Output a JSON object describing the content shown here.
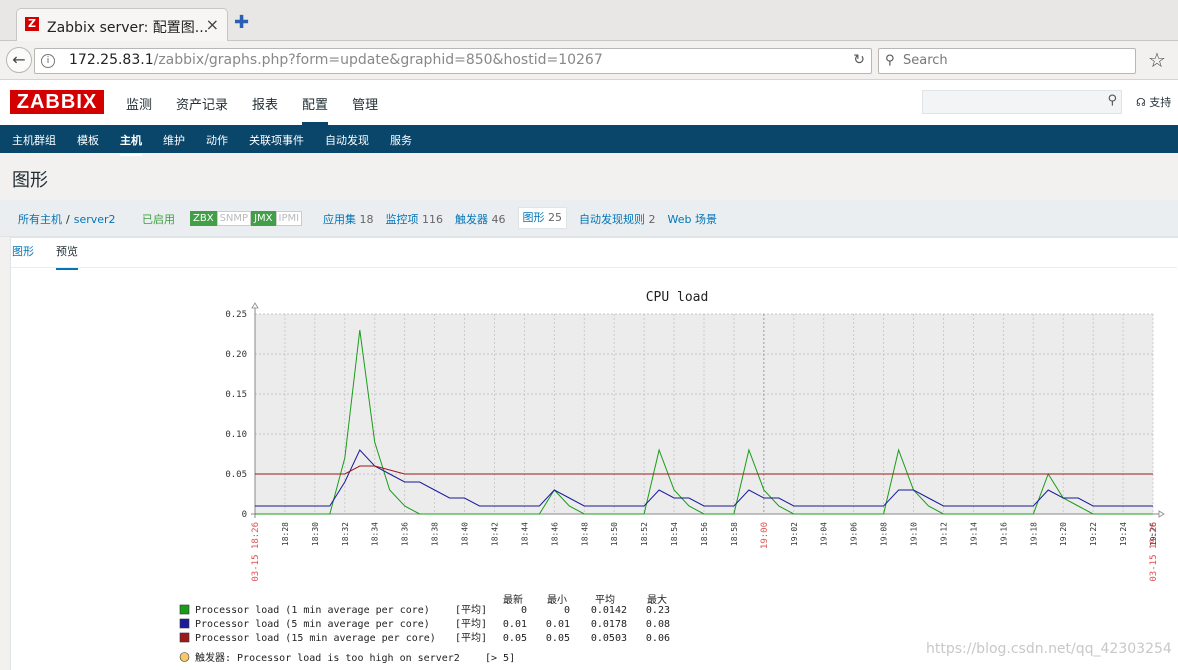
{
  "browser": {
    "tab_title": "Zabbix server: 配置图...",
    "tab_close": "×",
    "newtab": "✚",
    "favicon_text": "Z",
    "url_host": "172.25.83.1",
    "url_path": "/zabbix/graphs.php?form=update&graphid=850&hostid=10267",
    "search_placeholder": "Search"
  },
  "header": {
    "logo": "ZABBIX",
    "nav": [
      "监测",
      "资产记录",
      "报表",
      "配置",
      "管理"
    ],
    "active_nav": 3,
    "support": "支持"
  },
  "subnav": {
    "items": [
      "主机群组",
      "模板",
      "主机",
      "维护",
      "动作",
      "关联项事件",
      "自动发现",
      "服务"
    ],
    "active": 2
  },
  "page": {
    "title": "图形",
    "crumb_all": "所有主机",
    "crumb_sep": "/",
    "crumb_host": "server2",
    "status": "已启用",
    "availability": [
      "ZBX",
      "SNMP",
      "JMX",
      "IPMI"
    ],
    "host_links": [
      {
        "label": "应用集",
        "count": "18"
      },
      {
        "label": "监控项",
        "count": "116"
      },
      {
        "label": "触发器",
        "count": "46"
      },
      {
        "label": "图形",
        "count": "25"
      },
      {
        "label": "自动发现规则",
        "count": "2"
      },
      {
        "label": "Web 场景",
        "count": ""
      }
    ],
    "tabs": [
      "图形",
      "预览"
    ],
    "active_tab": 1
  },
  "colors": {
    "series1": "#1a9c1a",
    "series2": "#1a1a9c",
    "series3": "#9c1a1a",
    "trigger": "#f5c96a",
    "date_label": "#e05050"
  },
  "chart_data": {
    "type": "line",
    "title": "CPU load",
    "ylim": [
      0,
      0.25
    ],
    "yticks": [
      "0.25",
      "0.20",
      "0.15",
      "0.10",
      "0.05",
      "0"
    ],
    "ytick_values": [
      0.25,
      0.2,
      0.15,
      0.1,
      0.05,
      0
    ],
    "x_start": "18:26",
    "x_end": "19:26",
    "date_start": "03-15 18:26",
    "date_end": "03-15 19:26",
    "x_major": "19:00",
    "xtick_labels": [
      "18:28",
      "18:30",
      "18:32",
      "18:34",
      "18:36",
      "18:38",
      "18:40",
      "18:42",
      "18:44",
      "18:46",
      "18:48",
      "18:50",
      "18:52",
      "18:54",
      "18:56",
      "18:58",
      "19:00",
      "19:02",
      "19:04",
      "19:06",
      "19:08",
      "19:10",
      "19:12",
      "19:14",
      "19:16",
      "19:18",
      "19:20",
      "19:22",
      "19:24",
      "19:26"
    ],
    "legend_headers": [
      "最新",
      "最小",
      "平均",
      "最大"
    ],
    "series": [
      {
        "name": "Processor load (1 min average per core)",
        "agg": "[平均]",
        "last": "0",
        "min": "0",
        "avg": "0.0142",
        "max": "0.23",
        "minutes": [
          0,
          1,
          2,
          3,
          4,
          5,
          6,
          7,
          8,
          9,
          10,
          11,
          12,
          13,
          14,
          15,
          16,
          17,
          18,
          19,
          20,
          21,
          22,
          23,
          24,
          25,
          26,
          27,
          28,
          29,
          30,
          31,
          32,
          33,
          34,
          35,
          36,
          37,
          38,
          39,
          40,
          41,
          42,
          43,
          44,
          45,
          46,
          47,
          48,
          49,
          50,
          51,
          52,
          53,
          54,
          55,
          56,
          57,
          58,
          59,
          60
        ],
        "values": [
          0,
          0,
          0,
          0,
          0,
          0,
          0.07,
          0.23,
          0.09,
          0.03,
          0.01,
          0,
          0,
          0,
          0,
          0,
          0,
          0,
          0,
          0,
          0.03,
          0.01,
          0,
          0,
          0,
          0,
          0,
          0.08,
          0.03,
          0.01,
          0,
          0,
          0,
          0.08,
          0.03,
          0.01,
          0,
          0,
          0,
          0,
          0,
          0,
          0,
          0.08,
          0.03,
          0.01,
          0,
          0,
          0,
          0,
          0,
          0,
          0,
          0.05,
          0.02,
          0.01,
          0,
          0,
          0,
          0,
          0
        ]
      },
      {
        "name": "Processor load (5 min average per core)",
        "agg": "[平均]",
        "last": "0.01",
        "min": "0.01",
        "avg": "0.0178",
        "max": "0.08",
        "minutes": [
          0,
          1,
          2,
          3,
          4,
          5,
          6,
          7,
          8,
          9,
          10,
          11,
          12,
          13,
          14,
          15,
          16,
          17,
          18,
          19,
          20,
          21,
          22,
          23,
          24,
          25,
          26,
          27,
          28,
          29,
          30,
          31,
          32,
          33,
          34,
          35,
          36,
          37,
          38,
          39,
          40,
          41,
          42,
          43,
          44,
          45,
          46,
          47,
          48,
          49,
          50,
          51,
          52,
          53,
          54,
          55,
          56,
          57,
          58,
          59,
          60
        ],
        "values": [
          0.01,
          0.01,
          0.01,
          0.01,
          0.01,
          0.01,
          0.04,
          0.08,
          0.06,
          0.05,
          0.04,
          0.04,
          0.03,
          0.02,
          0.02,
          0.01,
          0.01,
          0.01,
          0.01,
          0.01,
          0.03,
          0.02,
          0.01,
          0.01,
          0.01,
          0.01,
          0.01,
          0.03,
          0.02,
          0.02,
          0.01,
          0.01,
          0.01,
          0.03,
          0.02,
          0.02,
          0.01,
          0.01,
          0.01,
          0.01,
          0.01,
          0.01,
          0.01,
          0.03,
          0.03,
          0.02,
          0.01,
          0.01,
          0.01,
          0.01,
          0.01,
          0.01,
          0.01,
          0.03,
          0.02,
          0.02,
          0.01,
          0.01,
          0.01,
          0.01,
          0.01
        ]
      },
      {
        "name": "Processor load (15 min average per core)",
        "agg": "[平均]",
        "last": "0.05",
        "min": "0.05",
        "avg": "0.0503",
        "max": "0.06",
        "minutes": [
          0,
          1,
          2,
          3,
          4,
          5,
          6,
          7,
          8,
          9,
          10,
          11,
          12,
          13,
          14,
          15,
          16,
          17,
          18,
          19,
          20,
          21,
          22,
          23,
          24,
          25,
          26,
          27,
          28,
          29,
          30,
          31,
          32,
          33,
          34,
          35,
          36,
          37,
          38,
          39,
          40,
          41,
          42,
          43,
          44,
          45,
          46,
          47,
          48,
          49,
          50,
          51,
          52,
          53,
          54,
          55,
          56,
          57,
          58,
          59,
          60
        ],
        "values": [
          0.05,
          0.05,
          0.05,
          0.05,
          0.05,
          0.05,
          0.05,
          0.06,
          0.06,
          0.055,
          0.05,
          0.05,
          0.05,
          0.05,
          0.05,
          0.05,
          0.05,
          0.05,
          0.05,
          0.05,
          0.05,
          0.05,
          0.05,
          0.05,
          0.05,
          0.05,
          0.05,
          0.05,
          0.05,
          0.05,
          0.05,
          0.05,
          0.05,
          0.05,
          0.05,
          0.05,
          0.05,
          0.05,
          0.05,
          0.05,
          0.05,
          0.05,
          0.05,
          0.05,
          0.05,
          0.05,
          0.05,
          0.05,
          0.05,
          0.05,
          0.05,
          0.05,
          0.05,
          0.05,
          0.05,
          0.05,
          0.05,
          0.05,
          0.05,
          0.05,
          0.05
        ]
      }
    ],
    "trigger": {
      "label": "触发器: Processor load is too high on server2",
      "condition": "[> 5]"
    },
    "grid": true
  },
  "watermark": "https://blog.csdn.net/qq_42303254"
}
